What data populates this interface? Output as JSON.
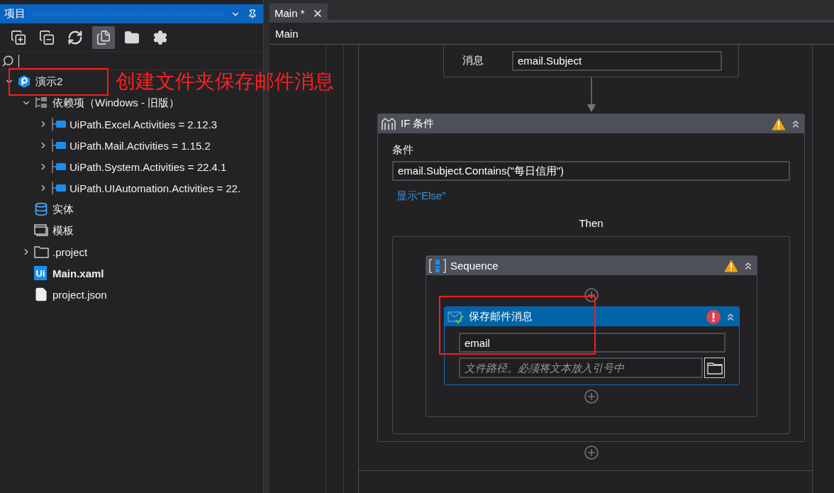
{
  "panel": {
    "title": "项目"
  },
  "toolbar": [
    {
      "kind": "expand",
      "selected": false
    },
    {
      "kind": "collapse",
      "selected": false
    },
    {
      "kind": "refresh",
      "selected": false
    },
    {
      "kind": "copy",
      "selected": true
    },
    {
      "kind": "folder",
      "selected": false
    },
    {
      "kind": "settings",
      "selected": false
    }
  ],
  "tree": [
    {
      "label": "演示2",
      "kind": "project",
      "expanded": true,
      "children": [
        {
          "label": "依赖项（Windows - 旧版）",
          "kind": "dependencies",
          "expanded": true,
          "children": [
            {
              "label": "UiPath.Excel.Activities = 2.12.3",
              "kind": "package",
              "expanded": false
            },
            {
              "label": "UiPath.Mail.Activities = 1.15.2",
              "kind": "package",
              "expanded": false
            },
            {
              "label": "UiPath.System.Activities = 22.4.1",
              "kind": "package",
              "expanded": false
            },
            {
              "label": "UiPath.UIAutomation.Activities = 22.",
              "kind": "package",
              "expanded": false
            }
          ]
        },
        {
          "label": "实体",
          "kind": "entities"
        },
        {
          "label": "模板",
          "kind": "templates"
        },
        {
          "label": ".project",
          "kind": "folder",
          "expanded": false
        },
        {
          "label": "Main.xaml",
          "kind": "xaml",
          "icon_text": "Ui"
        },
        {
          "label": "project.json",
          "kind": "file"
        }
      ]
    }
  ],
  "tabs": [
    {
      "label": "Main *",
      "selected": true
    }
  ],
  "breadcrumb": "Main",
  "designer": {
    "message_activity": {
      "label": "消息",
      "value": "email.Subject"
    },
    "if": {
      "title": "IF 条件",
      "warning": true,
      "condition_label": "条件",
      "condition": "email.Subject.Contains(\"每日信用\")",
      "else_link": "显示“Else”",
      "then_label": "Then",
      "sequence": {
        "title": "Sequence",
        "warning": true,
        "activity": {
          "title": "保存邮件消息",
          "error": true,
          "selected": true,
          "value": "email",
          "placeholder": "文件路径。必须将文本放入引号中"
        }
      }
    }
  },
  "annotations": [
    {
      "kind": "frame"
    },
    {
      "kind": "note",
      "text": "创建文件夹保存邮件消息"
    },
    {
      "kind": "frame"
    }
  ]
}
